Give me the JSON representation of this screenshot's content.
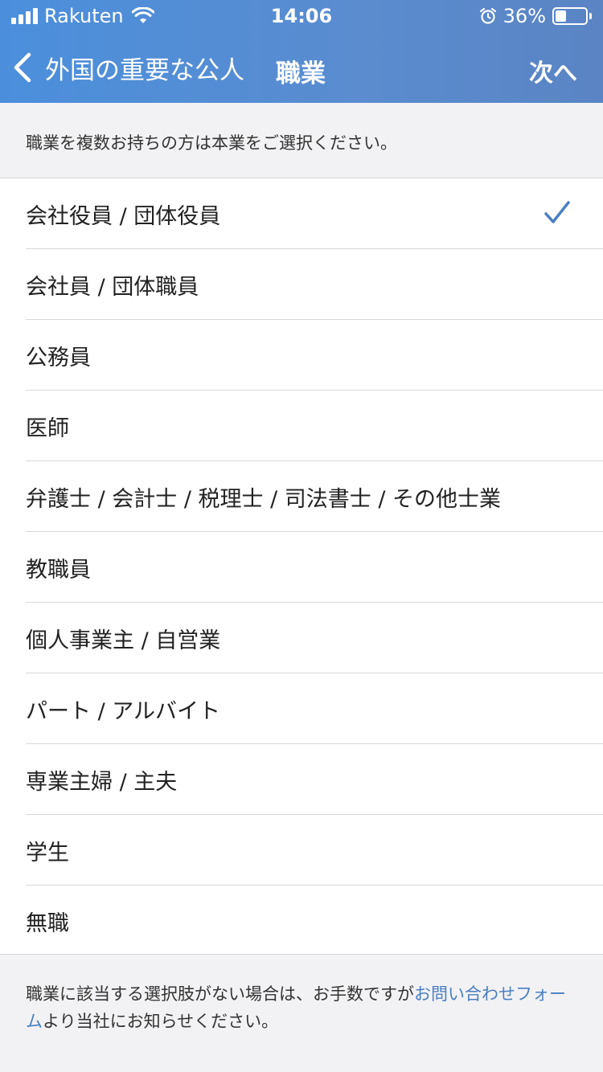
{
  "status_bar": {
    "carrier": "Rakuten",
    "time": "14:06",
    "battery": "36%",
    "battery_level": 0.36
  },
  "nav": {
    "back_label": "外国の重要な公人",
    "title": "職業",
    "next_label": "次へ"
  },
  "intro": "職業を複数お持ちの方は本業をご選択ください。",
  "occupations": [
    {
      "label": "会社役員 / 団体役員",
      "selected": true
    },
    {
      "label": "会社員 / 団体職員",
      "selected": false
    },
    {
      "label": "公務員",
      "selected": false
    },
    {
      "label": "医師",
      "selected": false
    },
    {
      "label": "弁護士 / 会計士 / 税理士 / 司法書士 / その他士業",
      "selected": false
    },
    {
      "label": "教職員",
      "selected": false
    },
    {
      "label": "個人事業主 / 自営業",
      "selected": false
    },
    {
      "label": "パート / アルバイト",
      "selected": false
    },
    {
      "label": "専業主婦 / 主夫",
      "selected": false
    },
    {
      "label": "学生",
      "selected": false
    },
    {
      "label": "無職",
      "selected": false
    }
  ],
  "footer": {
    "text_before": "職業に該当する選択肢がない場合は、お手数ですが",
    "link": "お問い合わせフォーム",
    "text_after": "より当社にお知らせください。"
  },
  "colors": {
    "header": "#4b8fdc",
    "accent": "#4a7fc4"
  }
}
